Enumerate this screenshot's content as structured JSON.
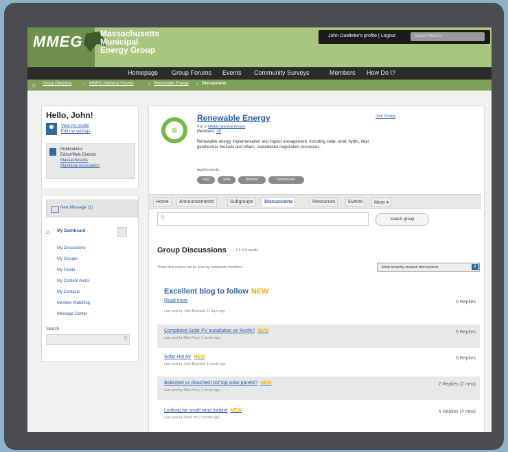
{
  "header": {
    "logo": "MMEG",
    "org_lines": [
      "Massachusetts",
      "Municipal",
      "Energy Group"
    ],
    "user_link": "John Ouellette's profile | Logout",
    "search_placeholder": "Search MMEG"
  },
  "nav": [
    "Homepage",
    "Group Forums",
    "Events",
    "Community Surveys",
    "Members",
    "How Do I?"
  ],
  "breadcrumb": [
    "Group Directory",
    "MMEG (General Forum)",
    "Renewable Energy",
    "Discussions"
  ],
  "sidebar": {
    "greeting": "Hello, John!",
    "profile_links": [
      "View my profile",
      "Edit my settings"
    ],
    "publications": {
      "line1": "Publications",
      "line2": "Editor/Web Director",
      "org1": "Massachusetts",
      "org2": "Municipal Association"
    },
    "new_message": "New Message (1)",
    "dashboard": "My Dashboard",
    "menu": [
      "My Discussions",
      "My Groups",
      "My Feeds",
      "My Content Alerts",
      "My Contacts",
      "Member Matching",
      "Message Center"
    ],
    "search_label": "Search"
  },
  "group": {
    "title": "Renewable Energy",
    "part_of_prefix": "Part of ",
    "part_of": "MMEG (General Forum)",
    "members_label": "Members: ",
    "members": "38",
    "join": "Join Group",
    "description": "Renewable energy implementation and impact management, including solar, wind, hydro, tidal, geothermal, biofuels and others; stakeholder negotiation processes.",
    "tags_label": "tags/keywords",
    "tags": [
      "solar",
      "wind",
      "biomass",
      "hydropower"
    ]
  },
  "tabs": [
    "Home",
    "Announcements",
    "Subgroups",
    "Discussions",
    "Resources",
    "Events",
    "More"
  ],
  "active_tab": "Discussions",
  "search_button": "search group",
  "discussions": {
    "title": "Group Discussions",
    "count": "1-5 of 8 results",
    "note": "These discussions can be seen by community members",
    "sort": "Most recently created discussions",
    "new_label": "NEW",
    "rows": [
      {
        "title": "Excellent blog to follow",
        "sub": "Last post by John Buckwell 21 days ago",
        "replies": "0 Replies",
        "extra": "Read more"
      },
      {
        "title": "Completed Solar PV installation on Roofs?",
        "sub": "Last post by Mike Perry 1 month ago",
        "replies": "0 Replies"
      },
      {
        "title": "Solar Hot Air",
        "sub": "Last post by John Buckwell 1 month ago",
        "replies": "0 Replies"
      },
      {
        "title": "Ballasted vs Attached roof top solar panels?",
        "sub": "Last post by Mike Perry 1 month ago",
        "replies": "2 Replies (2 new)"
      },
      {
        "title": "Looking for small wind turbine",
        "sub": "Last post by Helen Ho 2 months ago",
        "replies": "4 Replies (4 new)"
      }
    ]
  }
}
